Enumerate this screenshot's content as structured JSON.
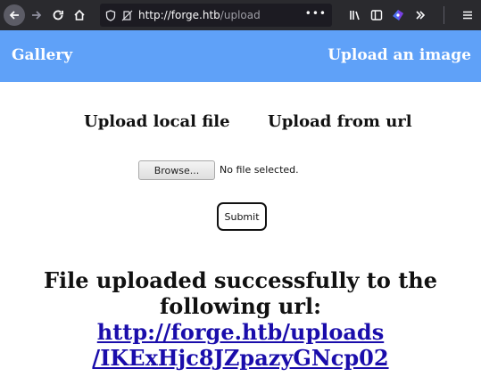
{
  "browser": {
    "url_host": "http://forge.htb",
    "url_path": "/upload",
    "url_more": "•••",
    "icons": {
      "back": "back-arrow-icon",
      "forward": "forward-arrow-icon",
      "reload": "reload-icon",
      "home": "home-icon",
      "shield": "tracking-shield-icon",
      "page": "page-info-icon",
      "library": "library-icon",
      "sidebar": "sidebar-icon",
      "extension": "extension-icon",
      "overflow": "overflow-chevrons-icon",
      "menu": "hamburger-menu-icon"
    }
  },
  "nav": {
    "gallery": "Gallery",
    "upload": "Upload an image",
    "bg_color": "#5fa1f8"
  },
  "upload": {
    "local_file": "Upload local file",
    "from_url": "Upload from url",
    "browse_label": "Browse...",
    "file_status": "No file selected.",
    "submit_label": "Submit"
  },
  "result": {
    "message": "File uploaded successfully to the following url:",
    "link_line1": "http://forge.htb/uploads",
    "link_line2": "/IKExHjc8JZpazyGNcp02"
  }
}
